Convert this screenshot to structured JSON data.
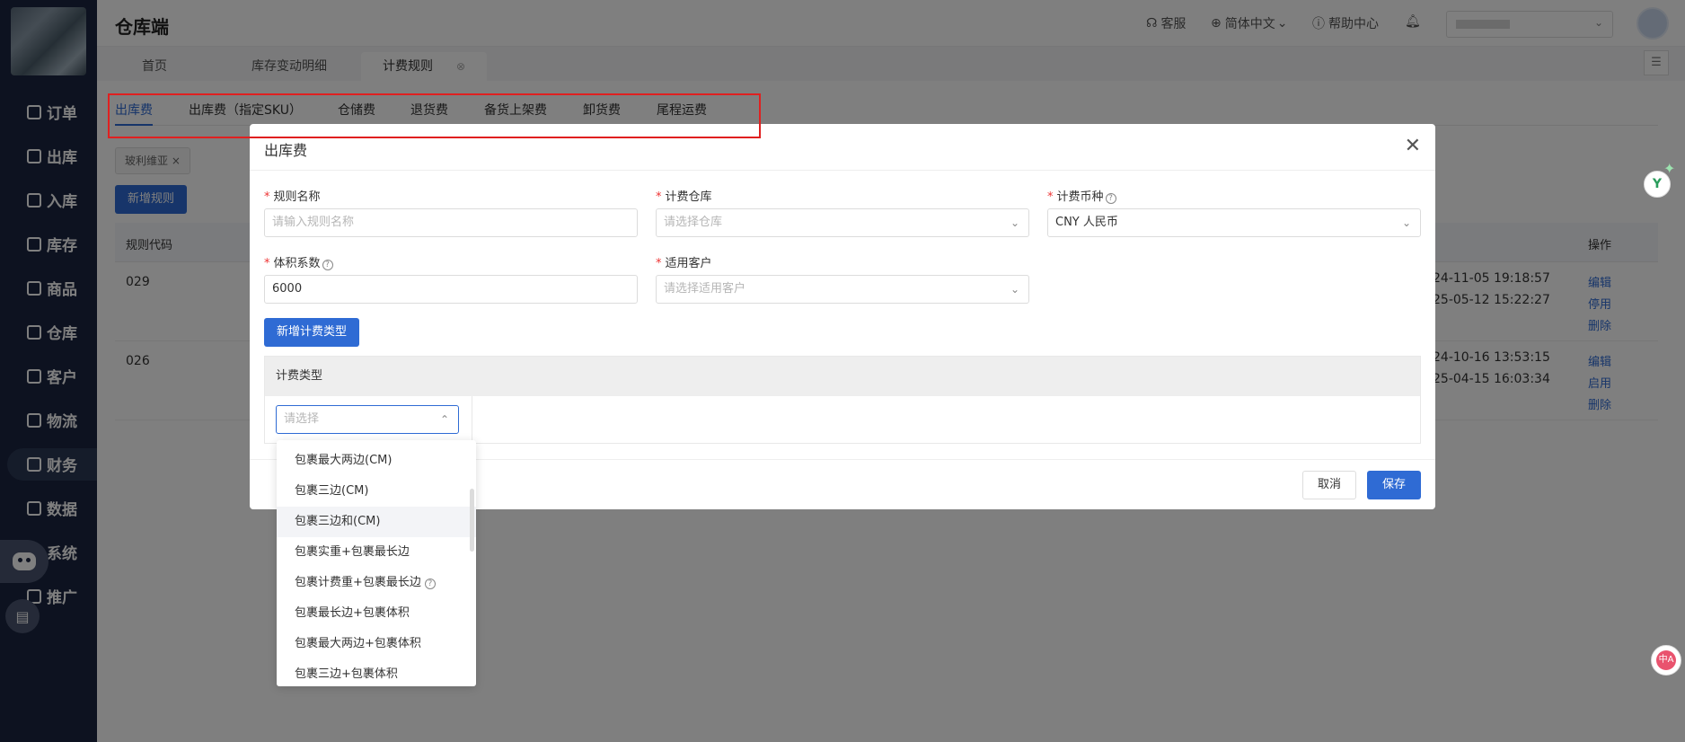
{
  "app": {
    "title": "仓库端"
  },
  "header": {
    "service": "客服",
    "language": "简体中文",
    "help": "帮助中心"
  },
  "sidebar": {
    "items": [
      {
        "label": "订单"
      },
      {
        "label": "出库"
      },
      {
        "label": "入库"
      },
      {
        "label": "库存"
      },
      {
        "label": "商品"
      },
      {
        "label": "仓库"
      },
      {
        "label": "客户"
      },
      {
        "label": "物流"
      },
      {
        "label": "财务"
      },
      {
        "label": "数据"
      },
      {
        "label": "系统"
      },
      {
        "label": "推广"
      }
    ],
    "active": "财务"
  },
  "page_tabs": [
    {
      "label": "首页"
    },
    {
      "label": "库存变动明细"
    },
    {
      "label": "计费规则"
    }
  ],
  "fee_tabs": [
    {
      "label": "出库费"
    },
    {
      "label": "出库费（指定SKU）"
    },
    {
      "label": "仓储费"
    },
    {
      "label": "退货费"
    },
    {
      "label": "备货上架费"
    },
    {
      "label": "卸货费"
    },
    {
      "label": "尾程运费"
    }
  ],
  "filter": {
    "chip": "玻利维亚"
  },
  "new_rule_button": "新增规则",
  "table": {
    "headers": {
      "code": "规则代码",
      "ops": "操作"
    },
    "rows": [
      {
        "code": "029",
        "time1": "24-11-05 19:18:57",
        "time2": "25-05-12 15:22:27",
        "ops": [
          "编辑",
          "停用",
          "删除"
        ]
      },
      {
        "code": "026",
        "time1": "24-10-16 13:53:15",
        "time2": "25-04-15 16:03:34",
        "ops": [
          "编辑",
          "启用",
          "删除"
        ]
      }
    ]
  },
  "modal": {
    "title": "出库费",
    "rule_name": {
      "label": "规则名称",
      "placeholder": "请输入规则名称"
    },
    "warehouse": {
      "label": "计费仓库",
      "placeholder": "请选择仓库"
    },
    "currency": {
      "label": "计费币种",
      "value": "CNY 人民币"
    },
    "volume_factor": {
      "label": "体积系数",
      "value": "6000"
    },
    "customer": {
      "label": "适用客户",
      "placeholder": "请选择适用客户"
    },
    "add_type_button": "新增计费类型",
    "type_table_header": "计费类型",
    "type_select_placeholder": "请选择",
    "cancel": "取消",
    "save": "保存"
  },
  "dropdown": {
    "options": [
      "包裹最大两边(CM)",
      "包裹三边(CM)",
      "包裹三边和(CM)",
      "包裹实重+包裹最长边",
      "包裹计费重+包裹最长边",
      "包裹最长边+包裹体积",
      "包裹最大两边+包裹体积",
      "包裹三边+包裹体积"
    ],
    "hovered": "包裹三边和(CM)"
  },
  "colors": {
    "primary": "#2f6bd4",
    "sidebar": "#1a2540",
    "highlight_box": "#e02020"
  }
}
